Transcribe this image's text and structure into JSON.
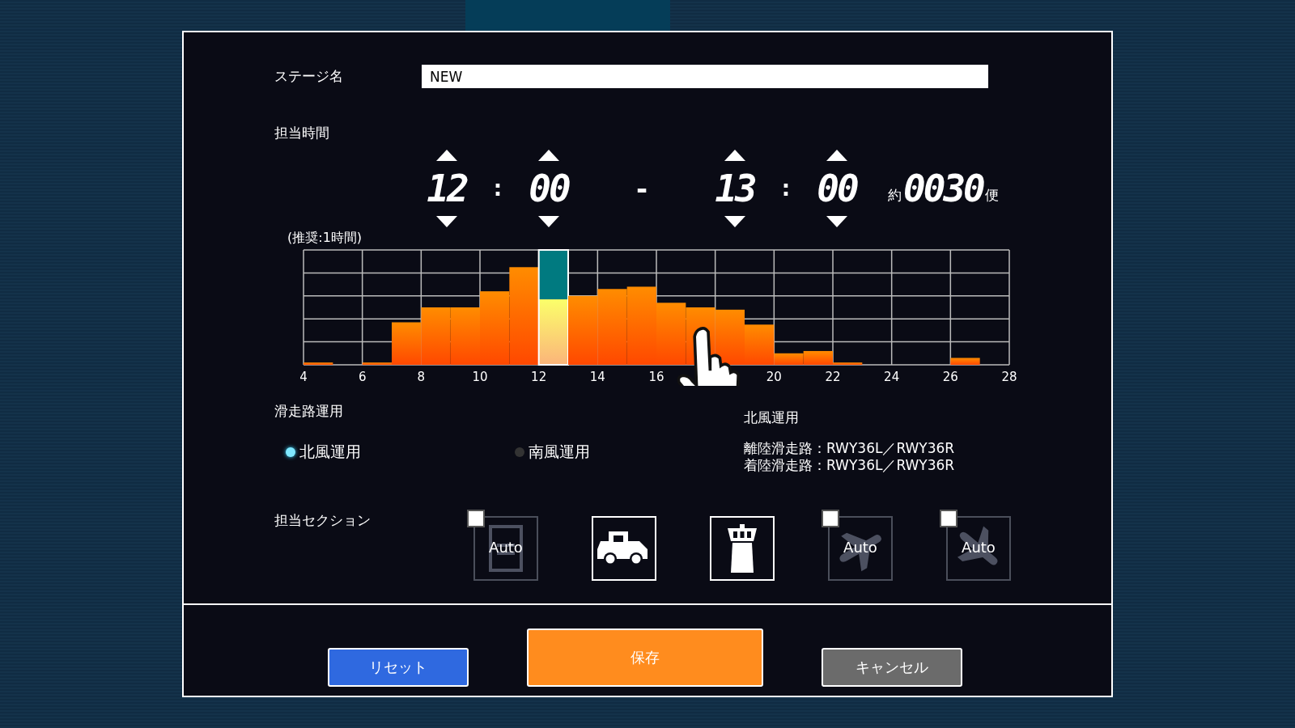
{
  "stage_name": {
    "label": "ステージ名",
    "value": "NEW"
  },
  "time": {
    "label": "担当時間",
    "start_hour": "12",
    "start_minute": "00",
    "end_hour": "13",
    "end_minute": "00",
    "colon": ":",
    "dash": "-",
    "approx_prefix": "約",
    "flights": "0030",
    "flights_suffix": "便"
  },
  "chart": {
    "note": "(推奨:1時間)",
    "x_labels": [
      "4",
      "6",
      "8",
      "10",
      "12",
      "14",
      "16",
      "20",
      "22",
      "24",
      "26",
      "28"
    ]
  },
  "runway": {
    "label": "滑走路運用",
    "options": [
      {
        "label": "北風運用",
        "selected": true
      },
      {
        "label": "南風運用",
        "selected": false
      }
    ],
    "info_title": "北風運用",
    "info_lines": [
      "離陸滑走路：RWY36L／RWY36R",
      "着陸滑走路：RWY36L／RWY36R"
    ]
  },
  "sections": {
    "label": "担当セクション",
    "items": [
      {
        "kind": "auto",
        "checked": false,
        "badge": "Auto"
      },
      {
        "kind": "fixed"
      },
      {
        "kind": "fixed"
      },
      {
        "kind": "auto",
        "checked": false,
        "badge": "Auto"
      },
      {
        "kind": "auto",
        "checked": false,
        "badge": "Auto"
      }
    ]
  },
  "buttons": [
    {
      "label": "リセット",
      "kind": "reset"
    },
    {
      "label": "保存",
      "kind": "save"
    },
    {
      "label": "キャンセル",
      "kind": "cancel"
    }
  ]
}
